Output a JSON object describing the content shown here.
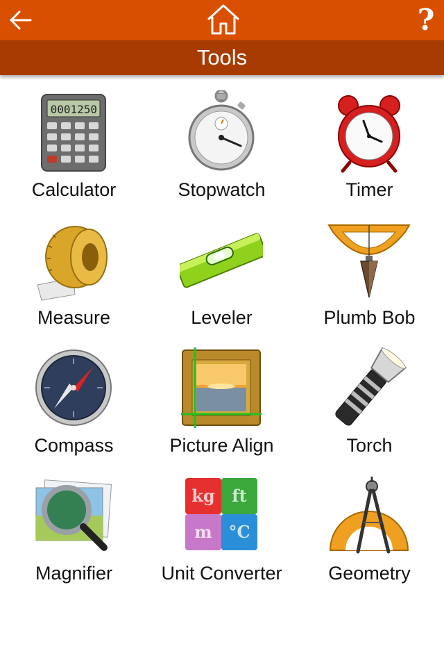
{
  "header": {
    "back_icon": "arrow-left-icon",
    "home_icon": "home-icon",
    "help_label": "?",
    "title": "Tools",
    "bar_color": "#d94f00",
    "subbar_color": "#a83c00"
  },
  "tools": [
    {
      "label": "Calculator",
      "icon": "calculator-icon"
    },
    {
      "label": "Stopwatch",
      "icon": "stopwatch-icon"
    },
    {
      "label": "Timer",
      "icon": "alarm-clock-icon"
    },
    {
      "label": "Measure",
      "icon": "tape-measure-icon"
    },
    {
      "label": "Leveler",
      "icon": "spirit-level-icon"
    },
    {
      "label": "Plumb Bob",
      "icon": "plumb-bob-icon"
    },
    {
      "label": "Compass",
      "icon": "compass-icon"
    },
    {
      "label": "Picture Align",
      "icon": "picture-frame-icon"
    },
    {
      "label": "Torch",
      "icon": "flashlight-icon"
    },
    {
      "label": "Magnifier",
      "icon": "magnifier-icon"
    },
    {
      "label": "Unit Converter",
      "icon": "unit-converter-icon"
    },
    {
      "label": "Geometry",
      "icon": "geometry-icon"
    }
  ],
  "calculator_display": "0001250",
  "converter_units": [
    "kg",
    "ft",
    "m",
    "°C"
  ]
}
